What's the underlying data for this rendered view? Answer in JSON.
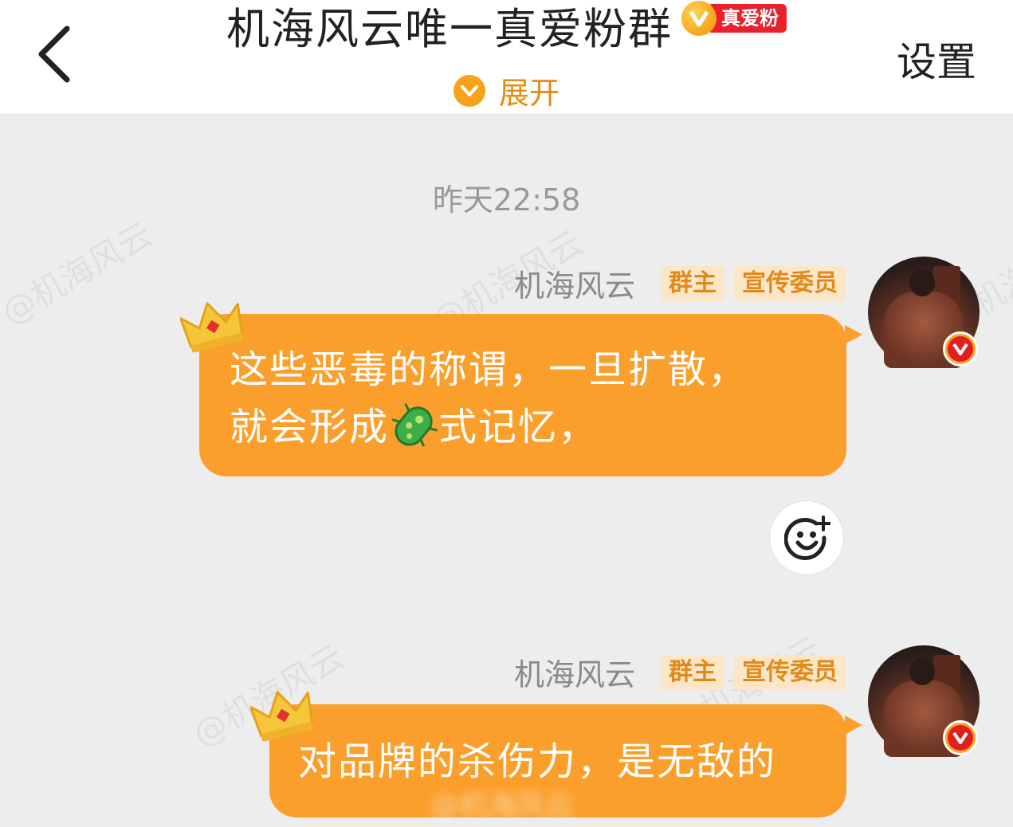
{
  "header": {
    "title": "机海风云唯一真爱粉群",
    "fan_badge_label": "真爱粉",
    "expand_label": "展开",
    "settings_label": "设置"
  },
  "chat": {
    "timestamp": "昨天22:58",
    "watermark": "@机海风云",
    "messages": [
      {
        "sender": "机海风云",
        "tags": [
          "群主",
          "宣传委员"
        ],
        "line1": "这些恶毒的称谓，一旦扩散，",
        "line2_before": "就会形成",
        "line2_emoji": "microbe-emoji",
        "line2_after": "式记忆，"
      },
      {
        "sender": "机海风云",
        "tags": [
          "群主",
          "宣传委员"
        ],
        "line1": "对品牌的杀伤力，是无敌的",
        "watermark_in_bubble": "@机海风云"
      }
    ]
  },
  "colors": {
    "bubble": "#fb9f2c",
    "accent": "#f7a21b",
    "tag_text": "#e08a1a",
    "tag_bg": "#fbe6c8",
    "badge_red": "#e8212b"
  }
}
